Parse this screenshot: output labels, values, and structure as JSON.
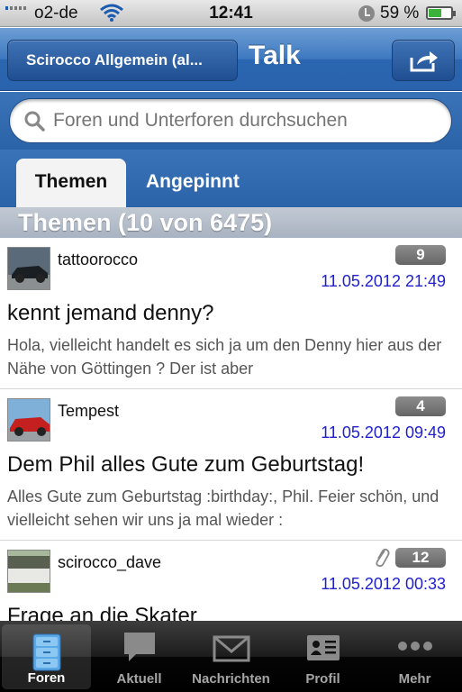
{
  "status_bar": {
    "carrier": "o2-de",
    "time": "12:41",
    "battery": "59 %"
  },
  "nav": {
    "back_label": "Scirocco Allgemein (al...",
    "title": "Talk",
    "share_icon": "share-icon"
  },
  "search": {
    "placeholder": "Foren und Unterforen durchsuchen"
  },
  "tabs": [
    {
      "label": "Themen",
      "active": true
    },
    {
      "label": "Angepinnt",
      "active": false
    }
  ],
  "section_header": "Themen (10 von 6475)",
  "topics": [
    {
      "author": "tattoorocco",
      "replies": "9",
      "date": "11.05.2012 21:49",
      "title": "kennt jemand denny?",
      "excerpt": "Hola,     vielleicht handelt es sich ja um den Denny hier aus der Nähe von Göttingen ? Der ist aber",
      "attachment": false
    },
    {
      "author": "Tempest",
      "replies": "4",
      "date": "11.05.2012 09:49",
      "title": "Dem Phil alles Gute zum Geburtstag!",
      "excerpt": "Alles Gute zum Geburtstag :birthday:, Phil. Feier schön, und vielleicht sehen wir uns ja mal wieder :",
      "attachment": false
    },
    {
      "author": "scirocco_dave",
      "replies": "12",
      "date": "11.05.2012 00:33",
      "title": "Frage an die Skater",
      "excerpt": "",
      "attachment": true
    }
  ],
  "bottom_tabs": [
    {
      "label": "Foren",
      "icon": "cabinet-icon",
      "selected": true
    },
    {
      "label": "Aktuell",
      "icon": "speech-bubble-icon",
      "selected": false
    },
    {
      "label": "Nachrichten",
      "icon": "envelope-icon",
      "selected": false
    },
    {
      "label": "Profil",
      "icon": "id-card-icon",
      "selected": false
    },
    {
      "label": "Mehr",
      "icon": "more-dots-icon",
      "selected": false
    }
  ],
  "colors": {
    "nav_blue": "#2a66b1",
    "date_blue": "#1f1fd0",
    "badge_gray": "#777777"
  }
}
